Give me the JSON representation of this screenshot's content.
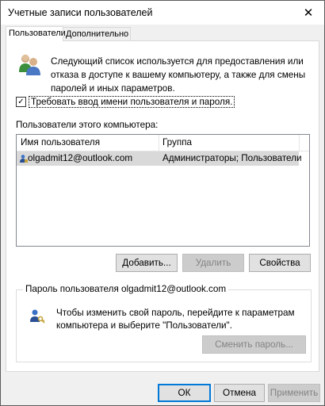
{
  "window": {
    "title": "Учетные записи пользователей"
  },
  "tabs": [
    {
      "label": "Пользователи",
      "active": true
    },
    {
      "label": "Дополнительно",
      "active": false
    }
  ],
  "intro": {
    "text": "Следующий список используется для предоставления или отказа в доступе к вашему компьютеру, а также для смены паролей и иных параметров.",
    "icon": "users-icon"
  },
  "require_login": {
    "label": "Требовать ввод имени пользователя и пароля.",
    "checked": true
  },
  "users_section": {
    "label": "Пользователи этого компьютера:"
  },
  "table": {
    "columns": [
      "Имя пользователя",
      "Группа"
    ],
    "rows": [
      {
        "user": "olgadmit12@outlook.com",
        "group": "Администраторы; Пользователи"
      }
    ]
  },
  "user_buttons": {
    "add": "Добавить...",
    "remove": "Удалить",
    "properties": "Свойства"
  },
  "password_group": {
    "legend": "Пароль пользователя olgadmit12@outlook.com",
    "text": "Чтобы изменить свой пароль, перейдите к параметрам компьютера и выберите \"Пользователи\".",
    "change_button": "Сменить пароль..."
  },
  "dialog_buttons": {
    "ok": "ОК",
    "cancel": "Отмена",
    "apply": "Применить"
  },
  "colors": {
    "accent": "#0078d7",
    "selection": "#d9d9d9"
  }
}
